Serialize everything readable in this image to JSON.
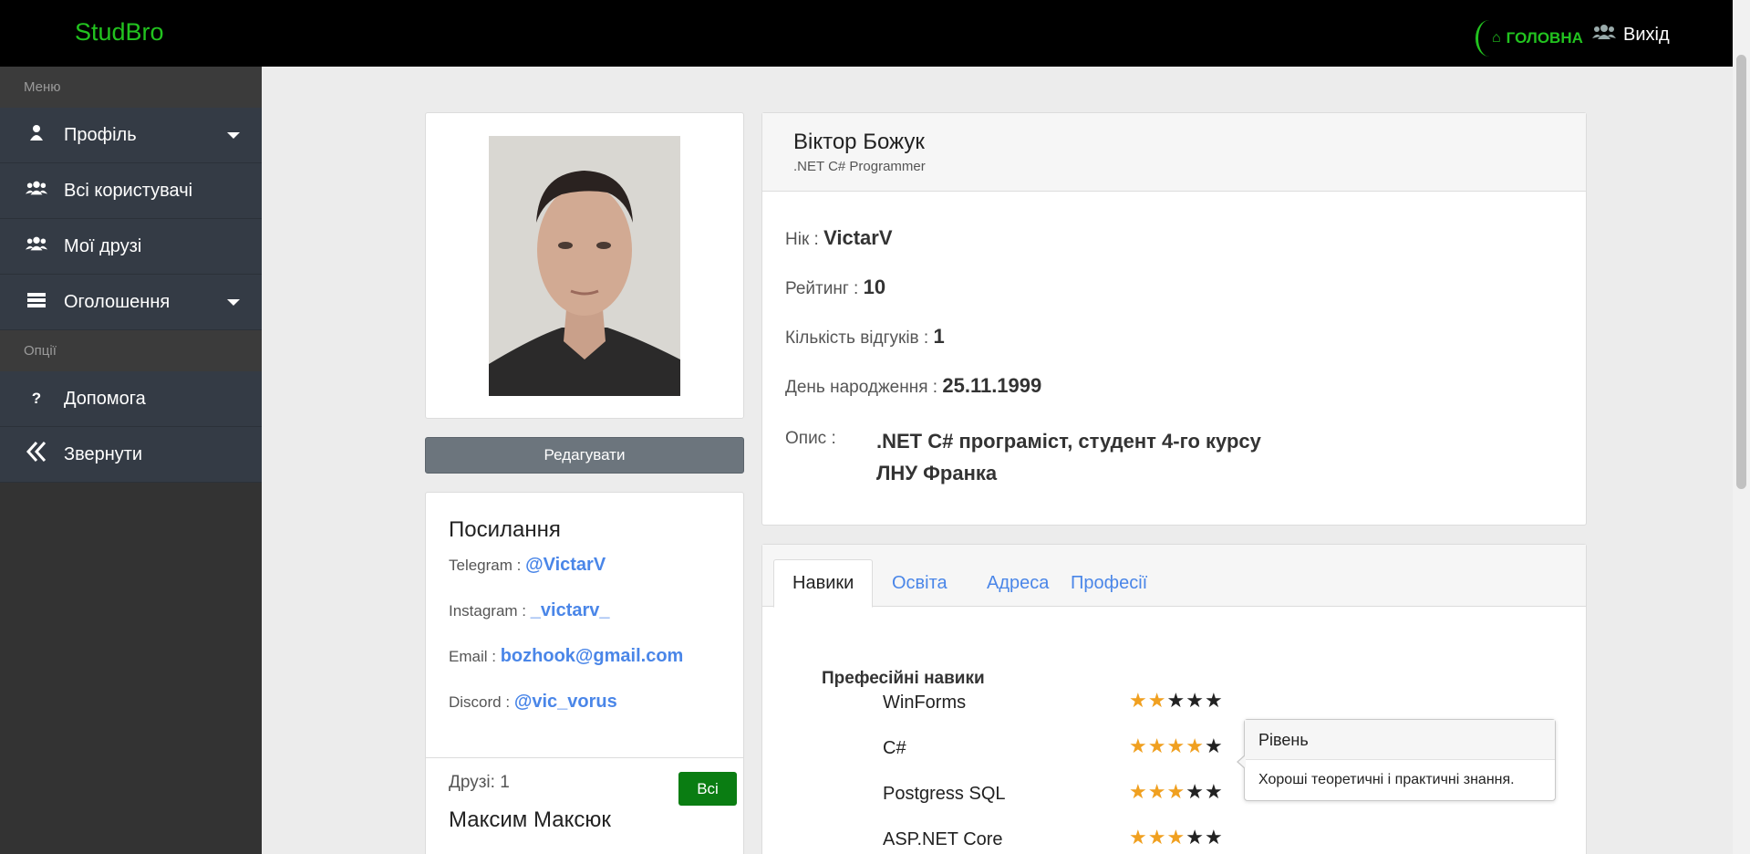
{
  "topbar": {
    "brand": "StudBro",
    "home_label": "ГОЛОВНА",
    "exit_label": "Вихід",
    "accent": "#22c31f"
  },
  "sidebar": {
    "menu_header": "Меню",
    "items": [
      {
        "label": "Профіль",
        "icon": "user-icon",
        "has_dropdown": true
      },
      {
        "label": "Всі користувачі",
        "icon": "users-icon",
        "has_dropdown": false
      },
      {
        "label": "Мої друзі",
        "icon": "users-icon",
        "has_dropdown": false
      },
      {
        "label": "Оголошення",
        "icon": "list-icon",
        "has_dropdown": true
      }
    ],
    "options_header": "Опції",
    "options": [
      {
        "label": "Допомога",
        "icon": "question-icon"
      },
      {
        "label": "Звернути",
        "icon": "double-chevron-left-icon"
      }
    ]
  },
  "profile": {
    "name": "Віктор Божук",
    "title": ".NET C# Programmer",
    "edit_label": "Редагувати",
    "fields": {
      "nick_label": "Нік :",
      "nick": "VictarV",
      "rating_label": "Рейтинг :",
      "rating": "10",
      "reviews_label": "Кількість відгуків :",
      "reviews": "1",
      "birthday_label": "День народження :",
      "birthday": "25.11.1999",
      "description_label": "Опис :",
      "description": ".NET C# програміст, студент 4-го курсу ЛНУ Франка"
    }
  },
  "links": {
    "title": "Посилання",
    "telegram_label": "Telegram :",
    "telegram": "@VictarV",
    "instagram_label": "Instagram :",
    "instagram": "_victarv_",
    "email_label": "Email :",
    "email": "bozhook@gmail.com",
    "discord_label": "Discord :",
    "discord": "@vic_vorus",
    "friends_label": "Друзі: 1",
    "all_label": "Всі",
    "friend_name": "Максим Максюк"
  },
  "tabs": [
    "Навики",
    "Освіта",
    "Адреса",
    "Професії"
  ],
  "skills": {
    "title": "Префесійні навики",
    "items": [
      {
        "name": "WinForms",
        "stars": 2,
        "max": 5
      },
      {
        "name": "C#",
        "stars": 4,
        "max": 5
      },
      {
        "name": "Postgress SQL",
        "stars": 3,
        "max": 5
      },
      {
        "name": "ASP.NET Core",
        "stars": 3,
        "max": 5
      }
    ]
  },
  "tooltip": {
    "title": "Рівень",
    "body": "Хороші теоретичні і практичні знання."
  }
}
